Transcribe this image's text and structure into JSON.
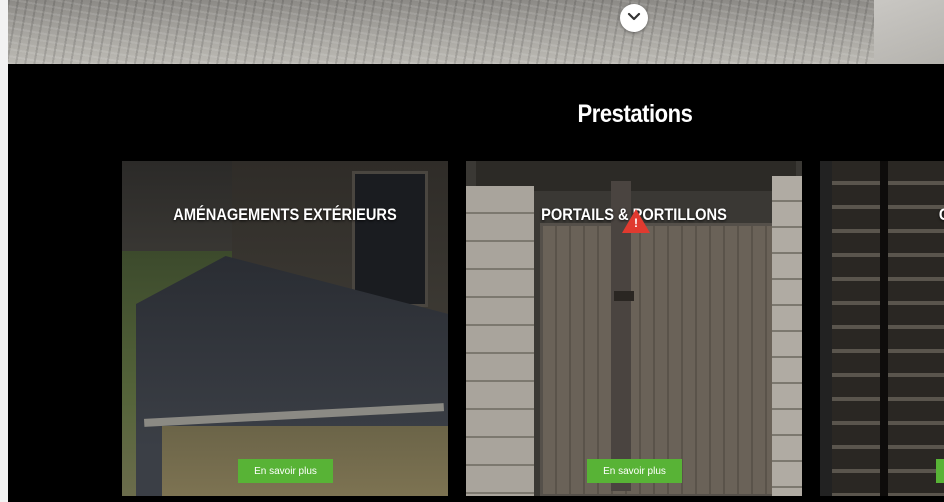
{
  "hero": {
    "scroll_icon": "chevron-down-icon"
  },
  "section": {
    "title": "Prestations"
  },
  "cards": [
    {
      "title": "AMÉNAGEMENTS EXTÉRIEURS",
      "button": "En savoir plus"
    },
    {
      "title": "PORTAILS & PORTILLONS",
      "button": "En savoir plus"
    },
    {
      "title": "C",
      "button": ""
    }
  ],
  "colors": {
    "accent": "#58b336",
    "warning": "#e03a2f",
    "background": "#000000"
  }
}
